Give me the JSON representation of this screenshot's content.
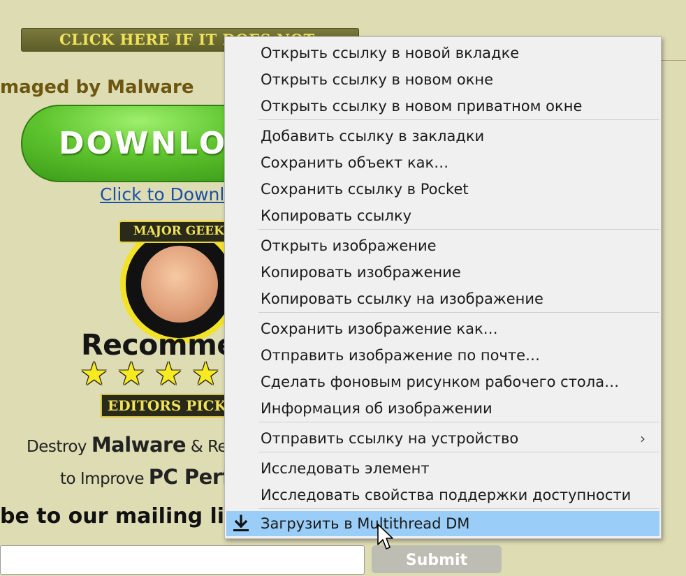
{
  "background_page": {
    "click_banner": "CLICK HERE IF IT DOES NOT",
    "section_title": "maged by Malware",
    "download_button": "DOWNLOAD",
    "download_link": "Click to Download",
    "badge_ribbon": "MAJOR GEEKS",
    "badge_text": "Recommended",
    "editors_pick": "EDITORS PICK",
    "promo_line1_pre": "Destroy ",
    "promo_line1_bold": "Malware",
    "promo_line1_post": " & Re",
    "promo_line2_pre": "to Improve ",
    "promo_line2_bold": "PC Perf",
    "mailing_list": "be to our mailing list a",
    "submit_button": "Submit"
  },
  "context_menu": {
    "groups": [
      {
        "items": [
          {
            "label": "Открыть ссылку в новой вкладке"
          },
          {
            "label": "Открыть ссылку в новом окне"
          },
          {
            "label": "Открыть ссылку в новом приватном окне"
          }
        ]
      },
      {
        "items": [
          {
            "label": "Добавить ссылку в закладки"
          },
          {
            "label": "Сохранить объект как…"
          },
          {
            "label": "Сохранить ссылку в Pocket"
          },
          {
            "label": "Копировать ссылку"
          }
        ]
      },
      {
        "items": [
          {
            "label": "Открыть изображение"
          },
          {
            "label": "Копировать изображение"
          },
          {
            "label": "Копировать ссылку на изображение"
          }
        ]
      },
      {
        "items": [
          {
            "label": "Сохранить изображение как…"
          },
          {
            "label": "Отправить изображение по почте…"
          },
          {
            "label": "Сделать фоновым рисунком рабочего стола…"
          },
          {
            "label": "Информация об изображении"
          }
        ]
      },
      {
        "items": [
          {
            "label": "Отправить ссылку на устройство",
            "submenu_arrow": "›"
          }
        ]
      },
      {
        "items": [
          {
            "label": "Исследовать элемент"
          },
          {
            "label": "Исследовать свойства поддержки доступности"
          }
        ]
      },
      {
        "items": [
          {
            "label": "Загрузить в Multithread DM",
            "icon": "download-arrow-icon",
            "highlighted": true
          }
        ]
      }
    ],
    "highlight_color": "#9acdf7"
  }
}
